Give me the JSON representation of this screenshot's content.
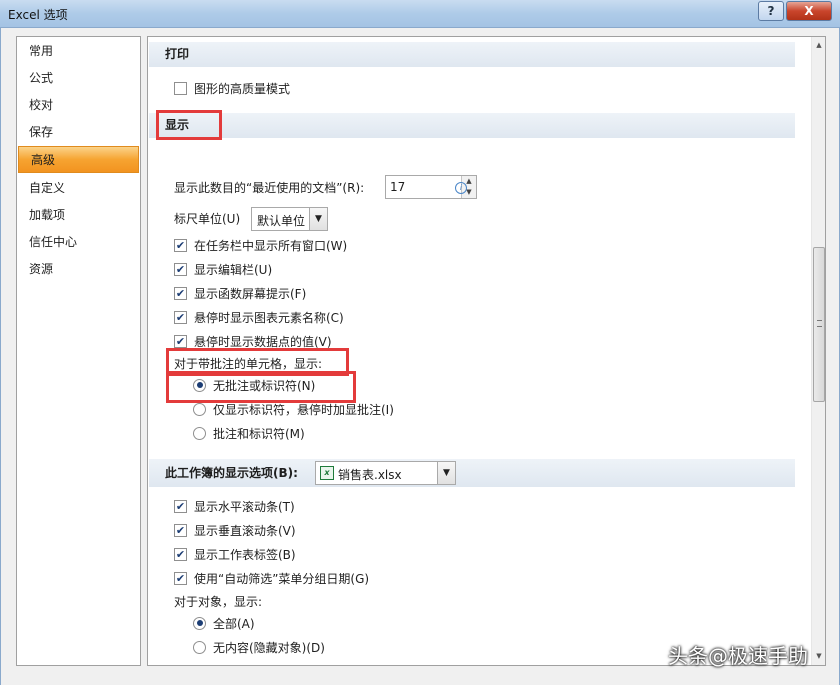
{
  "window": {
    "title": "Excel 选项",
    "help_label": "?",
    "close_label": "X"
  },
  "nav": {
    "items": [
      "常用",
      "公式",
      "校对",
      "保存",
      "高级",
      "自定义",
      "加载项",
      "信任中心",
      "资源"
    ],
    "active_index": 4
  },
  "print": {
    "header": "打印",
    "high_quality": {
      "label": "图形的高质量模式",
      "checked": false
    }
  },
  "display": {
    "header": "显示",
    "recent_docs_label": "显示此数目的“最近使用的文档”(R):",
    "recent_docs_value": "17",
    "ruler_label": "标尺单位(U)",
    "ruler_value": "默认单位",
    "checks": [
      {
        "label": "在任务栏中显示所有窗口(W)",
        "checked": true
      },
      {
        "label": "显示编辑栏(U)",
        "checked": true
      },
      {
        "label": "显示函数屏幕提示(F)",
        "checked": true
      },
      {
        "label": "悬停时显示图表元素名称(C)",
        "checked": true
      },
      {
        "label": "悬停时显示数据点的值(V)",
        "checked": true
      }
    ],
    "comments_label": "对于带批注的单元格，显示:",
    "comment_options": [
      {
        "label": "无批注或标识符(N)",
        "selected": true
      },
      {
        "label": "仅显示标识符，悬停时加显批注(I)",
        "selected": false
      },
      {
        "label": "批注和标识符(M)",
        "selected": false
      }
    ]
  },
  "workbook": {
    "header": "此工作簿的显示选项(B):",
    "file_name": "销售表.xlsx",
    "file_icon": "excel-file-icon",
    "checks": [
      {
        "label": "显示水平滚动条(T)",
        "checked": true
      },
      {
        "label": "显示垂直滚动条(V)",
        "checked": true
      },
      {
        "label": "显示工作表标签(B)",
        "checked": true
      },
      {
        "label": "使用“自动筛选”菜单分组日期(G)",
        "checked": true
      }
    ],
    "objects_label": "对于对象，显示:",
    "object_options": [
      {
        "label": "全部(A)",
        "selected": true
      },
      {
        "label": "无内容(隐藏对象)(D)",
        "selected": false
      }
    ]
  },
  "watermark": "头条@极速手助",
  "colors": {
    "highlight_box": "#e33b3b",
    "nav_active": "#f6a431"
  }
}
